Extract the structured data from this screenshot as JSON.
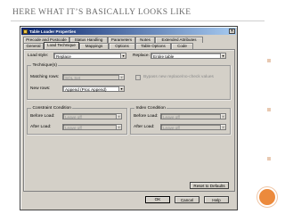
{
  "slide": {
    "title": "Here What It’s Basically Looks Like"
  },
  "window": {
    "title": "Table Loader Properties",
    "close_glyph": "✕"
  },
  "tabs": {
    "row1": [
      "Precode and Postcode",
      "Status Handling",
      "Parameters",
      "Notes",
      "Extended Attributes"
    ],
    "row2": [
      "General",
      "Load Technique",
      "Mappings",
      "Options",
      "Table Options",
      "Code"
    ],
    "active": "Load Technique"
  },
  "load": {
    "style_label": "Load style:",
    "style_value": "Replace",
    "replace_label": "Replace:",
    "replace_value": "Entire table"
  },
  "technique": {
    "group_title": "Technique(s)",
    "matching_label": "Matching rows:",
    "matching_value": "SQL Set",
    "new_label": "New rows:",
    "new_value": "Append (Proc Append)",
    "bypass_label": "Bypass new replace/no-check values"
  },
  "constraint": {
    "group_title": "Constraint Condition",
    "before_label": "Before Load:",
    "before_value": "Leave off",
    "after_label": "After Load:",
    "after_value": "Leave off"
  },
  "index": {
    "group_title": "Index Condition",
    "before_label": "Before Load:",
    "before_value": "Leave off",
    "after_label": "After Load:",
    "after_value": "Leave off"
  },
  "buttons": {
    "reset": "Reset to Defaults",
    "ok": "OK",
    "cancel": "Cancel",
    "help": "Help"
  },
  "icons": {
    "dropdown": "▼",
    "window": "table-loader-icon"
  },
  "colors": {
    "accent_orange": "#ec8a3c",
    "titlebar_start": "#0a246a",
    "titlebar_end": "#a6caf0",
    "dialog_face": "#d4d0c8"
  }
}
